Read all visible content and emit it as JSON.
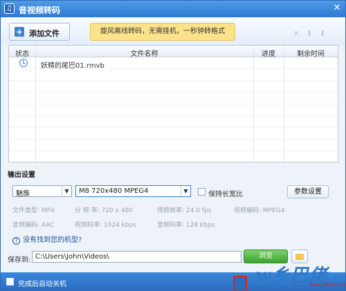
{
  "window": {
    "title": "音视频转码",
    "close_glyph": "✕"
  },
  "toolbar": {
    "add_file_label": "添加文件",
    "banner_text": "旋风离线转码，无需挂机，一秒钟转格式",
    "icons": [
      "close-icon",
      "arrow-up-icon",
      "arrow-down-icon"
    ]
  },
  "table": {
    "columns": [
      "状态",
      "文件名称",
      "进度",
      "剩余时间"
    ],
    "rows": [
      {
        "status_icon": "clock-icon",
        "filename": "妖精的尾巴01.rmvb",
        "progress": "",
        "remaining": ""
      }
    ]
  },
  "output": {
    "section_title": "输出设置",
    "brand_select": "魅族",
    "model_select": "M8 720x480 MPEG4",
    "keep_ratio_label": "保持长宽比",
    "keep_ratio_checked": false,
    "params_button": "参数设置",
    "info_line1": {
      "file_type": "文件类型:  MP4",
      "resolution": "分 辨 率:  720 x 480",
      "video_fps": "视频帧率:  24.0 fps",
      "video_codec": "视频编码:  MPEG4"
    },
    "info_line2": {
      "audio_codec": "音频编码:  AAC",
      "video_bitrate": "视频码率:  1024 kbps",
      "audio_bitrate": "音频码率:  128 kbps"
    },
    "help_link": "没有找到您的机型?",
    "save_label": "保存到:",
    "save_path": "C:\\Users\\John\\Videos\\",
    "browse_button": "浏览"
  },
  "bottom": {
    "shutdown_label": "完成后自动关机",
    "shutdown_checked": false
  },
  "watermark": {
    "text": "w乡巴佬",
    "url": "www.386w.com"
  },
  "colors": {
    "title_bar": "#2e7ad3",
    "banner": "#fde28c",
    "browse": "#3fa332",
    "highlight_box": "#d42424"
  }
}
